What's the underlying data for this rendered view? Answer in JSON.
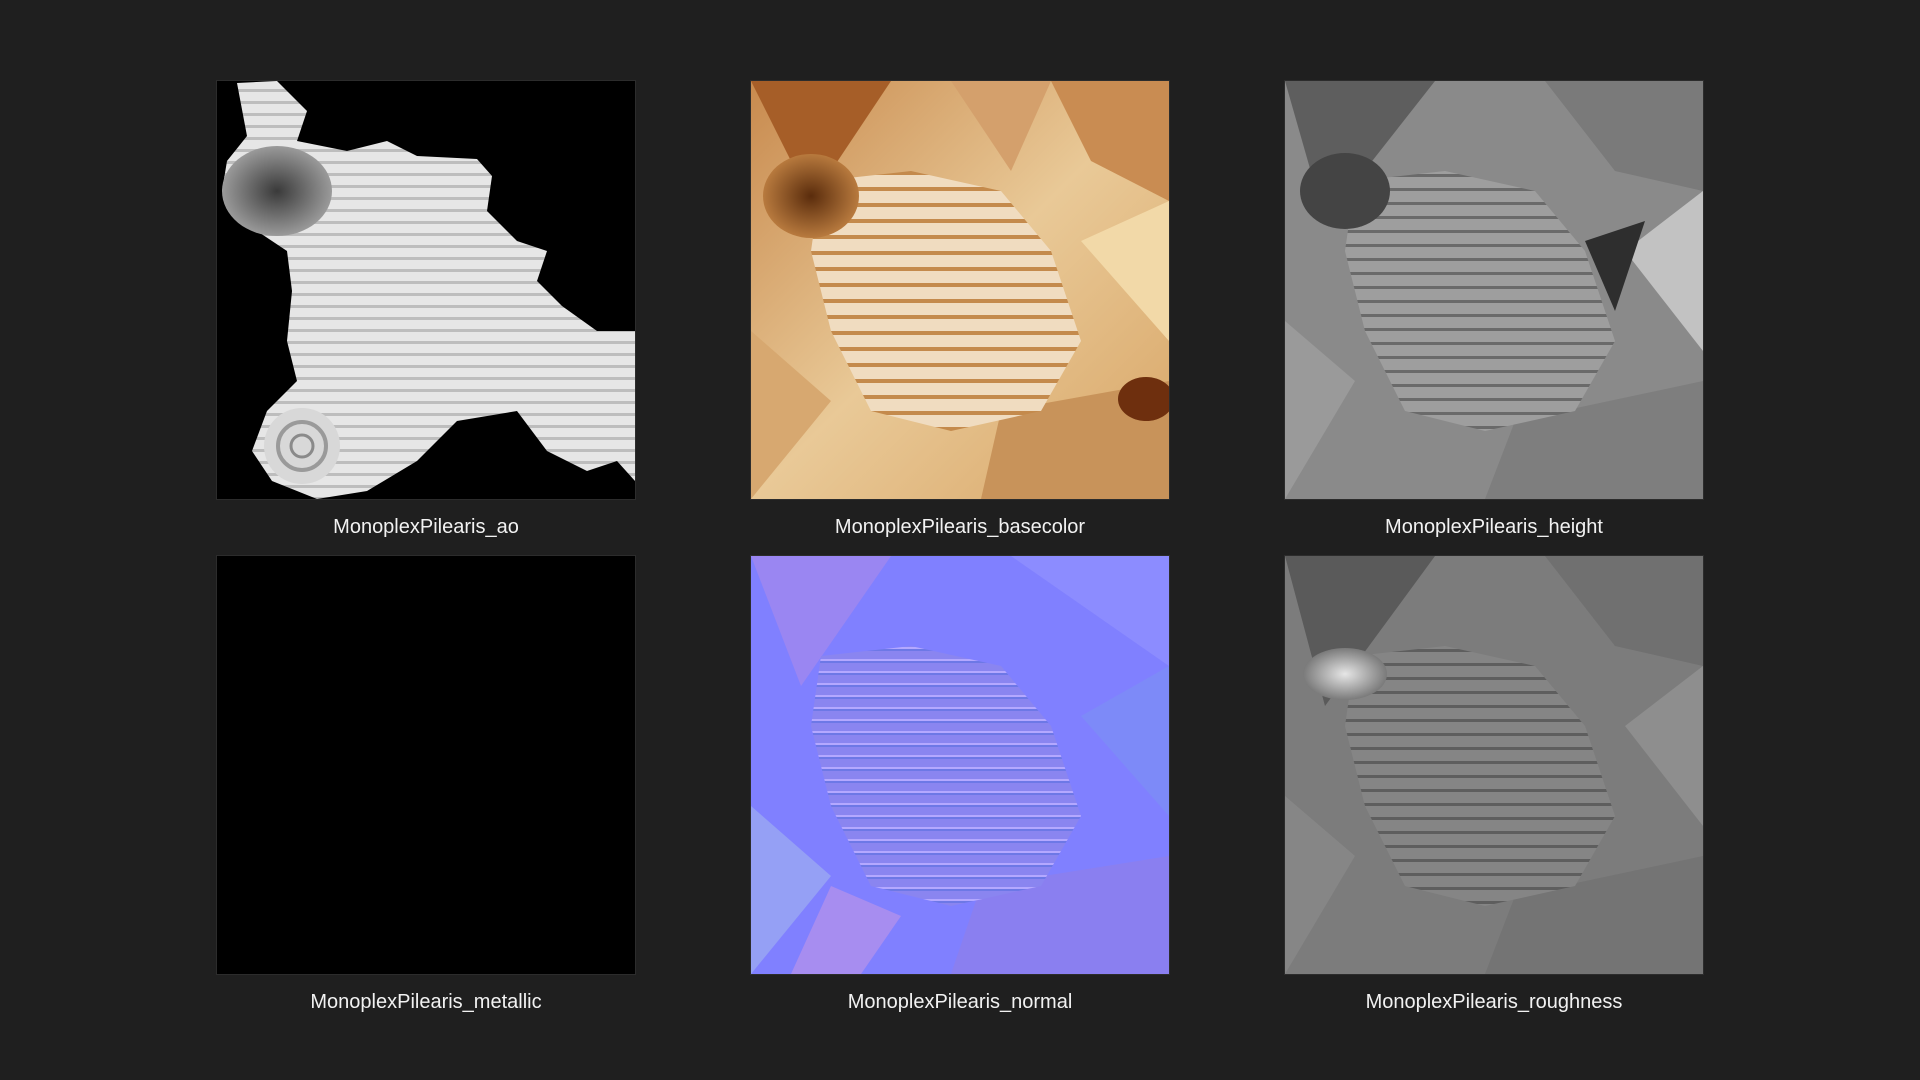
{
  "textures": [
    {
      "name": "MonoplexPilearis_ao",
      "icon": "ao-texture-thumbnail"
    },
    {
      "name": "MonoplexPilearis_basecolor",
      "icon": "basecolor-texture-thumbnail"
    },
    {
      "name": "MonoplexPilearis_height",
      "icon": "height-texture-thumbnail"
    },
    {
      "name": "MonoplexPilearis_metallic",
      "icon": "metallic-texture-thumbnail"
    },
    {
      "name": "MonoplexPilearis_normal",
      "icon": "normal-texture-thumbnail"
    },
    {
      "name": "MonoplexPilearis_roughness",
      "icon": "roughness-texture-thumbnail"
    }
  ],
  "colors": {
    "background": "#1f1f1f",
    "caption": "#f2f2f2",
    "metallic_fill": "#000000",
    "normal_base": "#8080ff"
  }
}
